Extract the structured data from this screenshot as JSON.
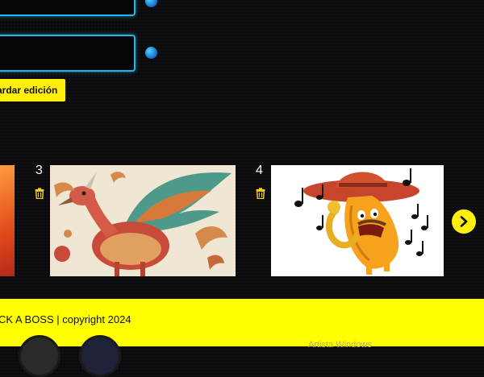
{
  "form": {
    "save_label": "ardar edición"
  },
  "carousel": {
    "items": [
      {
        "number": "3",
        "image": "anatomical-gryphon-illustration"
      },
      {
        "number": "4",
        "image": "pixel-sausage-mariachi-saxophone"
      }
    ],
    "next_icon": "chevron-right-icon",
    "delete_icon": "trash-icon"
  },
  "footer": {
    "copyright": "CK A BOSS | copyright 2024",
    "partial_text": "Artista Windows"
  },
  "colors": {
    "accent": "#ffef0a",
    "field_border": "#20b8e8",
    "background": "#0b0b0d"
  }
}
